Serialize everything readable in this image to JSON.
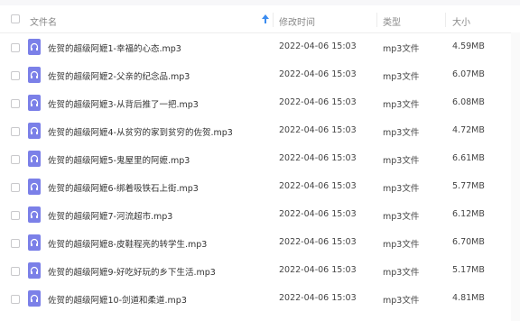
{
  "header": {
    "name_label": "文件名",
    "modified_label": "修改时间",
    "type_label": "类型",
    "size_label": "大小"
  },
  "files": [
    {
      "name": "佐贺的超级阿嬷1-幸福的心态.mp3",
      "modified": "2022-04-06 15:03",
      "type": "mp3文件",
      "size": "4.59MB"
    },
    {
      "name": "佐贺的超级阿嬷2-父亲的纪念品.mp3",
      "modified": "2022-04-06 15:03",
      "type": "mp3文件",
      "size": "6.07MB"
    },
    {
      "name": "佐贺的超级阿嬷3-从背后推了一把.mp3",
      "modified": "2022-04-06 15:03",
      "type": "mp3文件",
      "size": "6.08MB"
    },
    {
      "name": "佐贺的超级阿嬷4-从贫穷的家到贫穷的佐贺.mp3",
      "modified": "2022-04-06 15:03",
      "type": "mp3文件",
      "size": "4.72MB"
    },
    {
      "name": "佐贺的超级阿嬷5-鬼屋里的阿嬷.mp3",
      "modified": "2022-04-06 15:03",
      "type": "mp3文件",
      "size": "6.61MB"
    },
    {
      "name": "佐贺的超级阿嬷6-绑着吸铁石上街.mp3",
      "modified": "2022-04-06 15:03",
      "type": "mp3文件",
      "size": "5.77MB"
    },
    {
      "name": "佐贺的超级阿嬷7-河流超市.mp3",
      "modified": "2022-04-06 15:03",
      "type": "mp3文件",
      "size": "6.12MB"
    },
    {
      "name": "佐贺的超级阿嬷8-皮鞋程亮的转学生.mp3",
      "modified": "2022-04-06 15:03",
      "type": "mp3文件",
      "size": "6.70MB"
    },
    {
      "name": "佐贺的超级阿嬷9-好吃好玩的乡下生活.mp3",
      "modified": "2022-04-06 15:03",
      "type": "mp3文件",
      "size": "5.17MB"
    },
    {
      "name": "佐贺的超级阿嬷10-剑道和柔道.mp3",
      "modified": "2022-04-06 15:03",
      "type": "mp3文件",
      "size": "4.81MB"
    }
  ],
  "colors": {
    "icon": "#7b80e8",
    "sort_arrow": "#3b8cf0"
  },
  "icons": {
    "file": "headphones-icon",
    "sort": "sort-ascending-icon"
  }
}
